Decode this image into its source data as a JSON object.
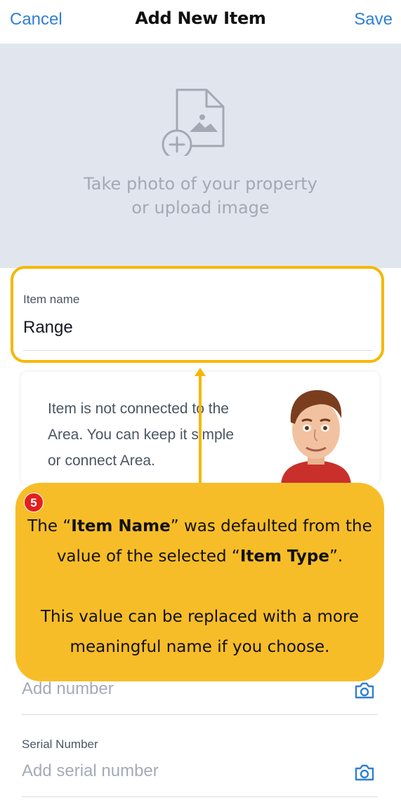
{
  "header": {
    "cancel_label": "Cancel",
    "title": "Add New Item",
    "save_label": "Save"
  },
  "photo_upload": {
    "line1": "Take photo of your property",
    "line2": "or upload image",
    "icon": "add-image-icon"
  },
  "item_name_field": {
    "label": "Item name",
    "value": "Range"
  },
  "info_card": {
    "text": "Item is not connected to the Area. You can keep it simple or connect Area.",
    "avatar": "assistant-avatar"
  },
  "callout": {
    "step_number": "5",
    "p1_before": "The “",
    "p1_bold1": "Item Name",
    "p1_mid": "” was defaulted from the value of the selected “",
    "p1_bold2": "Item Type",
    "p1_after": "”.",
    "p2": "This value can be replaced with a more meaningful name if you choose."
  },
  "model_number_field": {
    "placeholder": "Add number",
    "icon": "camera-icon"
  },
  "serial_number_field": {
    "label": "Serial Number",
    "placeholder": "Add serial number",
    "icon": "camera-icon"
  },
  "colors": {
    "link_blue": "#2f7fd6",
    "highlight_yellow": "#f5b800",
    "callout_fill": "#f7bd28",
    "badge_red": "#e31f1f",
    "photo_bg": "#e1e6ee"
  }
}
